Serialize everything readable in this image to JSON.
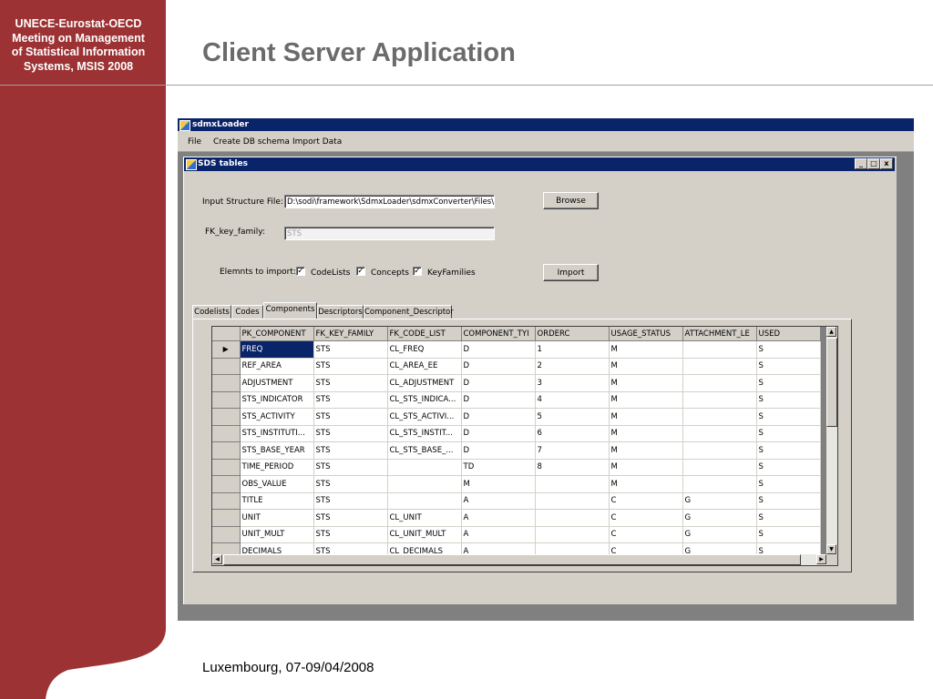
{
  "slide": {
    "org_lines": [
      "UNECE-Eurostat-OECD",
      "Meeting on Management",
      "of Statistical Information",
      "Systems, MSIS 2008"
    ],
    "title": "Client Server Application",
    "footer": "Luxembourg, 07-09/04/2008"
  },
  "colors": {
    "sidebar": "#9c3233",
    "title": "#6b6b6b",
    "titlebar": "#0a246a",
    "window": "#d4d0c8"
  },
  "app": {
    "title": "sdmxLoader",
    "menu": [
      "File",
      "Create DB schema",
      "Import Data"
    ]
  },
  "child": {
    "title": "SDS tables",
    "window_buttons": [
      "_",
      "□",
      "x"
    ],
    "input_structure_label": "Input Structure File:",
    "input_structure_value": "D:\\sodi\\framework\\SdmxLoader\\sdmxConverter\\Files\\Stru",
    "browse_label": "Browse",
    "fk_key_family_label": "FK_key_family:",
    "fk_key_family_value": "STS",
    "elements_label": "Elemnts to import:",
    "checkboxes": [
      {
        "label": "CodeLists",
        "checked": true
      },
      {
        "label": "Concepts",
        "checked": true
      },
      {
        "label": "KeyFamilies",
        "checked": true
      }
    ],
    "import_label": "Import",
    "tabs": [
      "Codelists",
      "Codes",
      "Components",
      "Descriptors",
      "Component_Descriptor"
    ],
    "active_tab": "Components"
  },
  "grid": {
    "columns": [
      "PK_COMPONENT",
      "FK_KEY_FAMILY",
      "FK_CODE_LIST",
      "COMPONENT_TYI",
      "ORDERC",
      "USAGE_STATUS",
      "ATTACHMENT_LE",
      "USED"
    ],
    "current_row_marker": "▶",
    "rows": [
      [
        "FREQ",
        "STS",
        "CL_FREQ",
        "D",
        "1",
        "M",
        "",
        "S"
      ],
      [
        "REF_AREA",
        "STS",
        "CL_AREA_EE",
        "D",
        "2",
        "M",
        "",
        "S"
      ],
      [
        "ADJUSTMENT",
        "STS",
        "CL_ADJUSTMENT",
        "D",
        "3",
        "M",
        "",
        "S"
      ],
      [
        "STS_INDICATOR",
        "STS",
        "CL_STS_INDICA...",
        "D",
        "4",
        "M",
        "",
        "S"
      ],
      [
        "STS_ACTIVITY",
        "STS",
        "CL_STS_ACTIVI...",
        "D",
        "5",
        "M",
        "",
        "S"
      ],
      [
        "STS_INSTITUTI...",
        "STS",
        "CL_STS_INSTIT...",
        "D",
        "6",
        "M",
        "",
        "S"
      ],
      [
        "STS_BASE_YEAR",
        "STS",
        "CL_STS_BASE_...",
        "D",
        "7",
        "M",
        "",
        "S"
      ],
      [
        "TIME_PERIOD",
        "STS",
        "",
        "TD",
        "8",
        "M",
        "",
        "S"
      ],
      [
        "OBS_VALUE",
        "STS",
        "",
        "M",
        "",
        "M",
        "",
        "S"
      ],
      [
        "TITLE",
        "STS",
        "",
        "A",
        "",
        "C",
        "G",
        "S"
      ],
      [
        "UNIT",
        "STS",
        "CL_UNIT",
        "A",
        "",
        "C",
        "G",
        "S"
      ],
      [
        "UNIT_MULT",
        "STS",
        "CL_UNIT_MULT",
        "A",
        "",
        "C",
        "G",
        "S"
      ],
      [
        "DECIMALS",
        "STS",
        "CL_DECIMALS",
        "A",
        "",
        "C",
        "G",
        "S"
      ]
    ],
    "scroll_arrows": {
      "up": "▲",
      "down": "▼",
      "left": "◀",
      "right": "▶"
    }
  }
}
